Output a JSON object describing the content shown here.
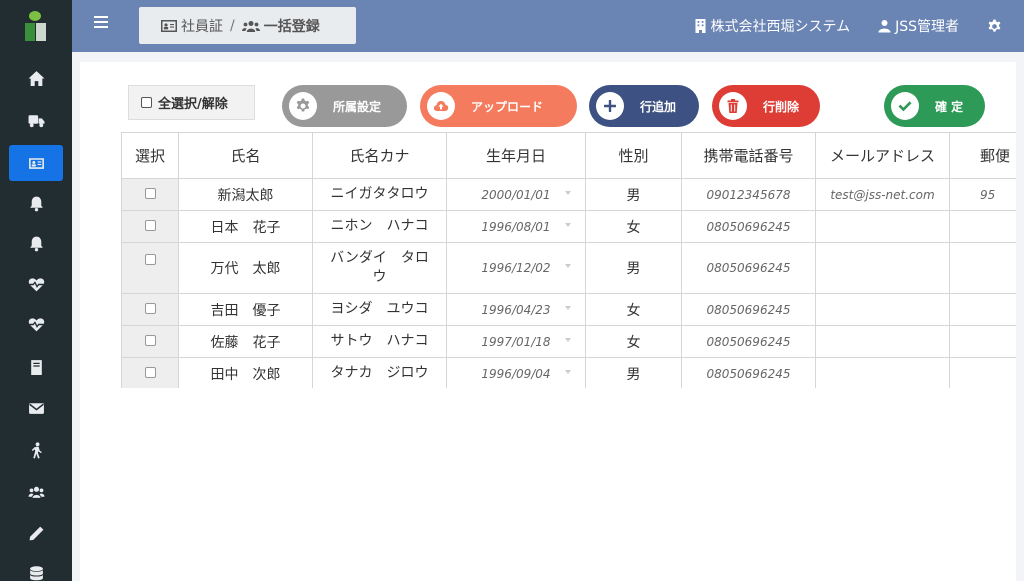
{
  "breadcrumb": {
    "parent": "社員証",
    "separator": "/",
    "current": "一括登録"
  },
  "header": {
    "company": "株式会社西堀システム",
    "user": "JSS管理者"
  },
  "toolbar": {
    "select_all": "全選択/解除",
    "affiliation": "所属設定",
    "upload": "アップロード",
    "add_row": "行追加",
    "delete_row": "行削除",
    "confirm": "確 定"
  },
  "table": {
    "columns": [
      "選択",
      "氏名",
      "氏名カナ",
      "生年月日",
      "性別",
      "携帯電話番号",
      "メールアドレス",
      "郵便"
    ],
    "rows": [
      {
        "name": "新潟太郎",
        "kana": "ニイガタタロウ",
        "birth": "2000/01/01",
        "gender": "男",
        "phone": "09012345678",
        "email": "test@jss-net.com",
        "zip": "95"
      },
      {
        "name": "日本　花子",
        "kana": "ニホン　ハナコ",
        "birth": "1996/08/01",
        "gender": "女",
        "phone": "08050696245",
        "email": "",
        "zip": ""
      },
      {
        "name": "万代　太郎",
        "kana": "バンダイ　タロウ",
        "birth": "1996/12/02",
        "gender": "男",
        "phone": "08050696245",
        "email": "",
        "zip": ""
      },
      {
        "name": "吉田　優子",
        "kana": "ヨシダ　ユウコ",
        "birth": "1996/04/23",
        "gender": "女",
        "phone": "08050696245",
        "email": "",
        "zip": ""
      },
      {
        "name": "佐藤　花子",
        "kana": "サトウ　ハナコ",
        "birth": "1997/01/18",
        "gender": "女",
        "phone": "08050696245",
        "email": "",
        "zip": ""
      },
      {
        "name": "田中　次郎",
        "kana": "タナカ　ジロウ",
        "birth": "1996/09/04",
        "gender": "男",
        "phone": "08050696245",
        "email": "",
        "zip": ""
      }
    ]
  },
  "colors": {
    "sidebar": "#222d32",
    "topbar": "#6a84b4",
    "active": "#1573e6",
    "upload": "#f47b5e",
    "add": "#3d5182",
    "delete": "#dd3d34",
    "confirm": "#2e9a58",
    "affiliation": "#999999"
  },
  "sidebar_icons": [
    "home-icon",
    "truck-icon",
    "id-card-icon",
    "bell-icon",
    "bell-icon",
    "heartbeat-icon",
    "heartbeat-icon",
    "book-icon",
    "envelope-icon",
    "walking-icon",
    "users-icon",
    "pencil-icon",
    "database-icon"
  ]
}
